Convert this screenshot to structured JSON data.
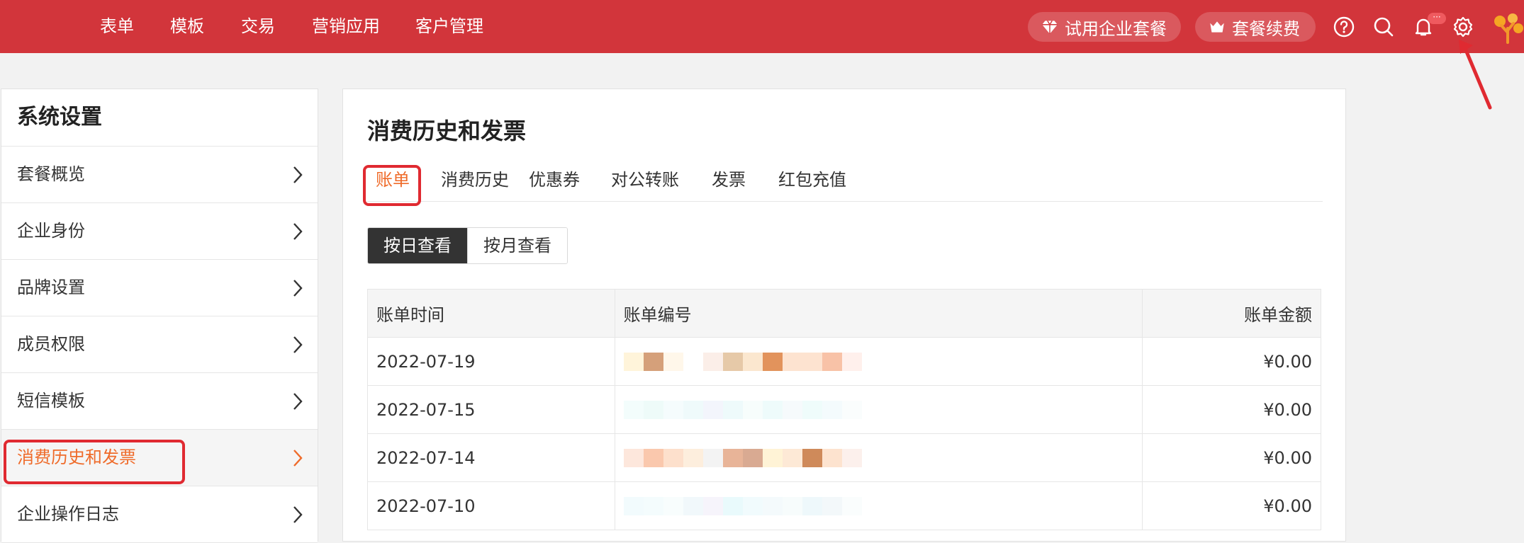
{
  "topnav": {
    "items": [
      "表单",
      "模板",
      "交易",
      "营销应用",
      "客户管理"
    ],
    "trial_label": "试用企业套餐",
    "renew_label": "套餐续费",
    "notification_badge": "···"
  },
  "sidebar": {
    "title": "系统设置",
    "items": [
      {
        "label": "套餐概览"
      },
      {
        "label": "企业身份"
      },
      {
        "label": "品牌设置"
      },
      {
        "label": "成员权限"
      },
      {
        "label": "短信模板"
      },
      {
        "label": "消费历史和发票"
      },
      {
        "label": "企业操作日志"
      }
    ],
    "active_index": 5
  },
  "main": {
    "title": "消费历史和发票",
    "tabs": [
      "账单",
      "消费历史",
      "优惠券",
      "对公转账",
      "发票",
      "红包充值"
    ],
    "active_tab": 0,
    "view_toggle": {
      "by_day": "按日查看",
      "by_month": "按月查看",
      "selected": "by_day"
    },
    "table": {
      "columns": [
        "账单时间",
        "账单编号",
        "账单金额"
      ],
      "rows": [
        {
          "date": "2022-07-19",
          "amount": "¥0.00"
        },
        {
          "date": "2022-07-15",
          "amount": "¥0.00"
        },
        {
          "date": "2022-07-14",
          "amount": "¥0.00"
        },
        {
          "date": "2022-07-10",
          "amount": "¥0.00"
        }
      ]
    }
  },
  "colors": {
    "brand_red": "#d2353b",
    "accent_orange": "#ef6b2a",
    "annotation_red": "#e02a31"
  }
}
